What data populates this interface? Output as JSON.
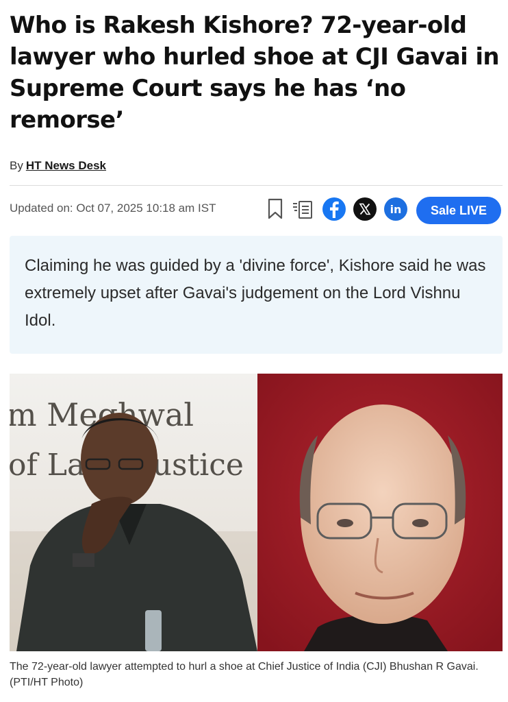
{
  "article": {
    "headline": "Who is Rakesh Kishore? 72-year-old lawyer who hurled shoe at CJI Gavai in Supreme Court says he has ‘no remorse’",
    "byline_prefix": "By",
    "author": "HT News Desk",
    "updated": "Updated on: Oct 07, 2025 10:18 am IST",
    "summary": "Claiming he was guided by a 'divine force', Kishore said he was extremely upset after Gavai's judgement on the Lord Vishnu Idol.",
    "caption": "The 72-year-old lawyer attempted to hurl a shoe at Chief Justice of India (CJI) Bhushan R Gavai.(PTI/HT Photo)"
  },
  "actions": {
    "bookmark_icon": "bookmark-icon",
    "article_icon": "article-icon",
    "facebook_icon": "facebook-icon",
    "x_icon": "x-icon",
    "linkedin_icon": "linkedin-icon",
    "sale_live_label": "Sale LIVE"
  },
  "hero_image": {
    "backdrop_text_line1": "m Meghwal",
    "backdrop_text_line2": "of La   x Justice"
  },
  "colors": {
    "headline": "#111111",
    "summary_bg": "#eef6fb",
    "sale_button": "#1f6ef0",
    "facebook": "#1877f2",
    "linkedin": "#1d6fe0",
    "x": "#111111",
    "right_panel": "#9c1a24"
  }
}
